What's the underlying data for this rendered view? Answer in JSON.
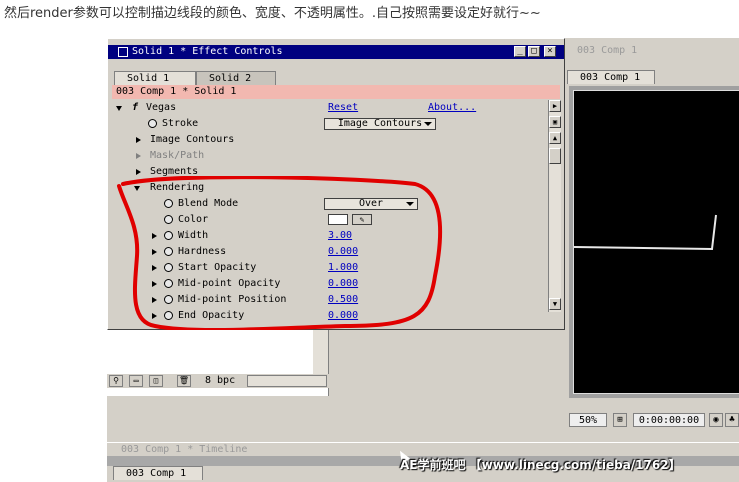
{
  "caption": "然后render参数可以控制描边线段的颜色、宽度、不透明属性。.自己按照需要设定好就行~~",
  "effect_controls": {
    "title": "Solid 1 * Effect Controls",
    "tabs": [
      "Solid 1",
      "Solid 2"
    ],
    "comp_path": "003 Comp 1 * Solid 1",
    "effect_name": "Vegas",
    "reset_label": "Reset",
    "about_label": "About...",
    "stroke_label": "Stroke",
    "stroke_value": "Image Contours",
    "image_contours_label": "Image Contours",
    "mask_path_label": "Mask/Path",
    "segments_label": "Segments",
    "rendering_label": "Rendering",
    "properties": [
      {
        "label": "Blend Mode",
        "value": "Over"
      },
      {
        "label": "Color",
        "value": ""
      },
      {
        "label": "Width",
        "value": "3.00"
      },
      {
        "label": "Hardness",
        "value": "0.000"
      },
      {
        "label": "Start Opacity",
        "value": "1.000"
      },
      {
        "label": "Mid-point Opacity",
        "value": "0.000"
      },
      {
        "label": "Mid-point Position",
        "value": "0.500"
      },
      {
        "label": "End Opacity",
        "value": "0.000"
      }
    ],
    "color_value": "#ffffff"
  },
  "project_toolbar": {
    "bpc_label": "8 bpc"
  },
  "comp_panel": {
    "title": "003 Comp 1",
    "tab_label": "003 Comp 1",
    "zoom": "50%",
    "timecode": "0:00:00:00"
  },
  "timeline": {
    "title": "003 Comp 1 * Timeline",
    "tab_label": "003 Comp 1"
  },
  "watermark": "AE学前班吧 【www.linecg.com/tieba/1762】"
}
